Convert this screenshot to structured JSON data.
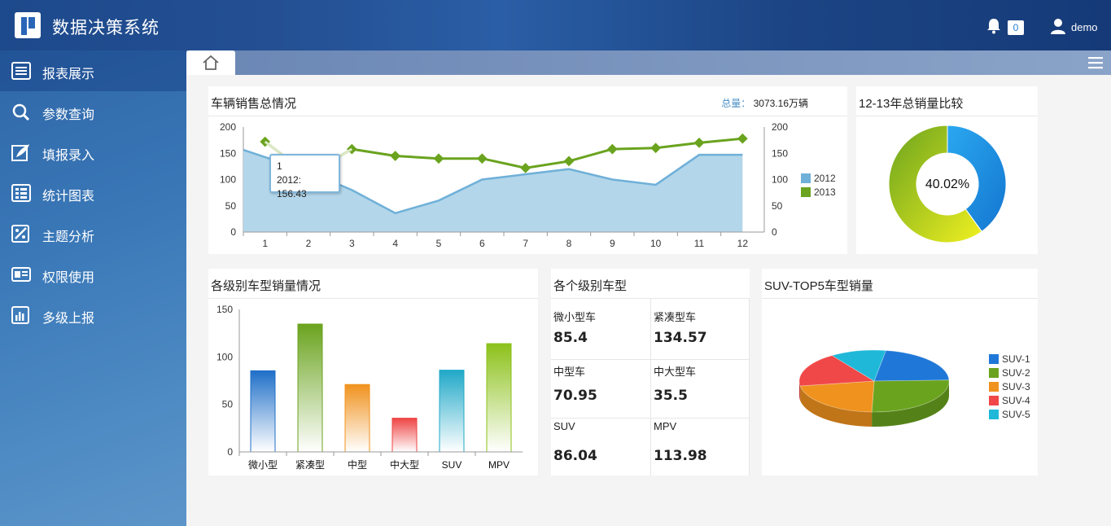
{
  "app": {
    "title": "数据决策系统",
    "notification_count": "0",
    "username": "demo"
  },
  "sidebar": {
    "items": [
      {
        "label": "报表展示",
        "icon": "report-icon"
      },
      {
        "label": "参数查询",
        "icon": "search-icon"
      },
      {
        "label": "填报录入",
        "icon": "feather-icon"
      },
      {
        "label": "统计图表",
        "icon": "chart-list-icon"
      },
      {
        "label": "主题分析",
        "icon": "analysis-icon"
      },
      {
        "label": "权限使用",
        "icon": "permission-icon"
      },
      {
        "label": "多级上报",
        "icon": "bar-chart-icon"
      }
    ]
  },
  "dashboard": {
    "sales": {
      "title": "车辆销售总情况",
      "total_label": "总量：",
      "total_value": "3073.16万辆",
      "tooltip_line1": "1",
      "tooltip_line2": "2012: 156.43"
    },
    "compare": {
      "title": "12-13年总销量比较",
      "center_label": "40.02%"
    },
    "level_bar": {
      "title": "各级别车型销量情况"
    },
    "level_grid": {
      "title": "各个级别车型",
      "cells": [
        {
          "label": "微小型车",
          "value": "85.4"
        },
        {
          "label": "紧凑型车",
          "value": "134.57"
        },
        {
          "label": "中型车",
          "value": "70.95"
        },
        {
          "label": "中大型车",
          "value": "35.5"
        },
        {
          "label": "SUV",
          "value": "86.04"
        },
        {
          "label": "MPV",
          "value": "113.98"
        }
      ]
    },
    "suv": {
      "title": "SUV-TOP5车型销量"
    }
  },
  "chart_data": [
    {
      "type": "area+line",
      "title": "车辆销售总情况",
      "categories": [
        "1",
        "2",
        "3",
        "4",
        "5",
        "6",
        "7",
        "8",
        "9",
        "10",
        "11",
        "12"
      ],
      "ylim": [
        0,
        200
      ],
      "yticks": [
        0,
        50,
        100,
        150,
        200
      ],
      "legend_position": "right",
      "series": [
        {
          "name": "2012",
          "type": "area",
          "color": "#6fb0d8",
          "values": [
            156.43,
            115,
            80,
            36,
            60,
            100,
            110,
            120,
            100,
            90,
            147,
            147
          ]
        },
        {
          "name": "2013",
          "type": "line",
          "color": "#6aa31e",
          "values": [
            172,
            110,
            158,
            145,
            140,
            140,
            122,
            135,
            158,
            160,
            170,
            178
          ]
        }
      ]
    },
    {
      "type": "pie",
      "subtype": "donut",
      "title": "12-13年总销量比较",
      "slices": [
        {
          "value": 40.02,
          "color": "#1a8fe0"
        },
        {
          "value": 59.98,
          "color": "#8cc11a"
        }
      ],
      "center_label": "40.02%"
    },
    {
      "type": "bar",
      "title": "各级别车型销量情况",
      "categories": [
        "微小型",
        "紧凑型",
        "中型",
        "中大型",
        "SUV",
        "MPV"
      ],
      "values": [
        85.4,
        134.57,
        70.95,
        35.5,
        86.04,
        113.98
      ],
      "colors": [
        "#1f6fc8",
        "#6aa31e",
        "#f0921e",
        "#ee4444",
        "#20a8c8",
        "#8cc11a"
      ],
      "ylim": [
        0,
        150
      ],
      "yticks": [
        0,
        50,
        100,
        150
      ]
    },
    {
      "type": "pie",
      "subtype": "3d",
      "title": "SUV-TOP5车型销量",
      "legend_position": "right",
      "slices": [
        {
          "name": "SUV-1",
          "value": 22,
          "color": "#1f78d8"
        },
        {
          "name": "SUV-2",
          "value": 26,
          "color": "#6aa31e"
        },
        {
          "name": "SUV-3",
          "value": 22,
          "color": "#f0921e"
        },
        {
          "name": "SUV-4",
          "value": 18,
          "color": "#f04848"
        },
        {
          "name": "SUV-5",
          "value": 12,
          "color": "#20b8d8"
        }
      ]
    }
  ]
}
